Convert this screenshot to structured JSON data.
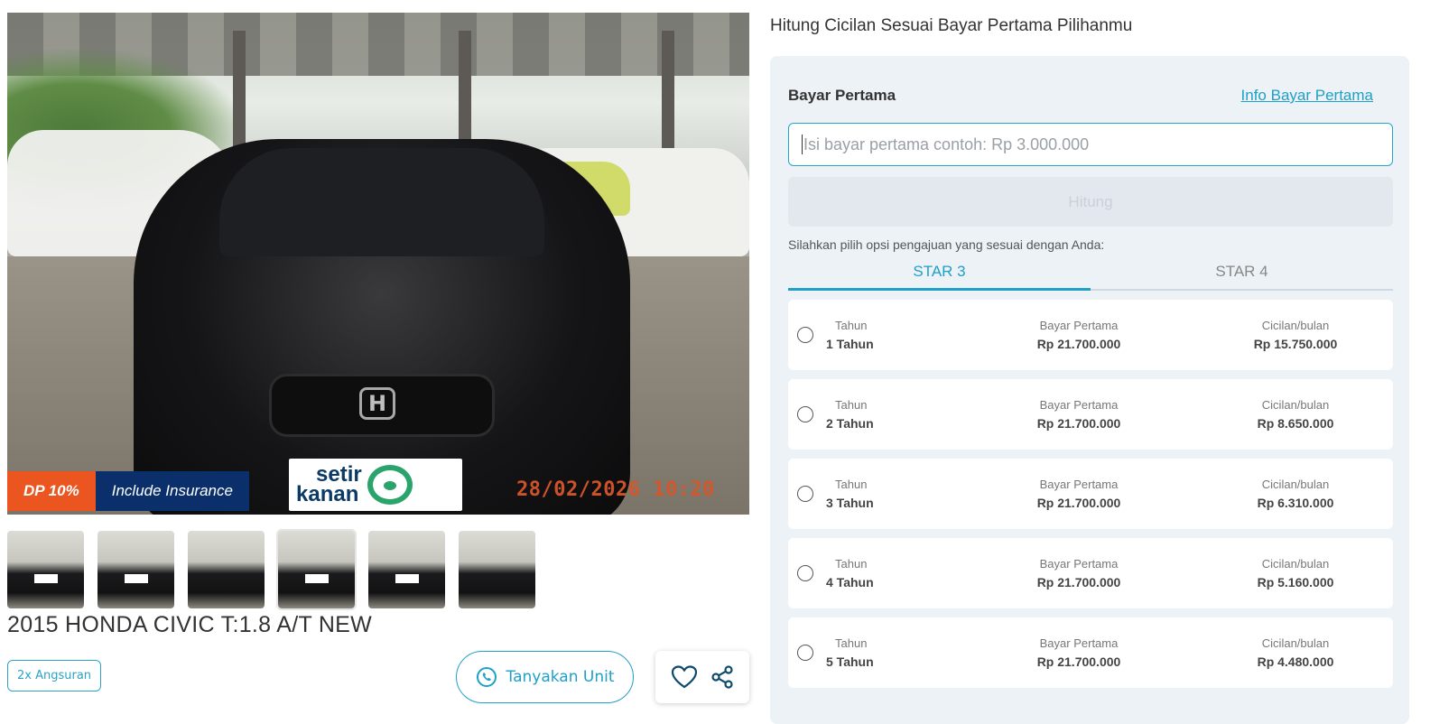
{
  "hero": {
    "dp_badge": "DP 10%",
    "insurance_badge": "Include Insurance",
    "plate_line1": "setir",
    "plate_line2": "kanan",
    "timestamp": "28/02/2026 10:20"
  },
  "car": {
    "title": "2015 HONDA CIVIC T:1.8 A/T NEW"
  },
  "actions": {
    "angsuran": "2x Angsuran",
    "ask_unit": "Tanyakan Unit"
  },
  "calc": {
    "heading": "Hitung Cicilan Sesuai Bayar Pertama Pilihanmu",
    "bayar_pertama_label": "Bayar Pertama",
    "info_link": "Info Bayar Pertama",
    "input_placeholder": "Isi bayar pertama contoh: Rp 3.000.000",
    "hitung_button": "Hitung",
    "hint": "Silahkan pilih opsi pengajuan yang sesuai dengan Anda:",
    "tabs": [
      {
        "label": "STAR 3",
        "active": true
      },
      {
        "label": "STAR 4",
        "active": false
      }
    ],
    "col_tenor_label": "Tahun",
    "col_dp_label": "Bayar Pertama",
    "col_install_label": "Cicilan/bulan",
    "options": [
      {
        "tenor": "1 Tahun",
        "dp": "Rp 21.700.000",
        "installment": "Rp 15.750.000"
      },
      {
        "tenor": "2 Tahun",
        "dp": "Rp 21.700.000",
        "installment": "Rp 8.650.000"
      },
      {
        "tenor": "3 Tahun",
        "dp": "Rp 21.700.000",
        "installment": "Rp 6.310.000"
      },
      {
        "tenor": "4 Tahun",
        "dp": "Rp 21.700.000",
        "installment": "Rp 5.160.000"
      },
      {
        "tenor": "5 Tahun",
        "dp": "Rp 21.700.000",
        "installment": "Rp 4.480.000"
      }
    ]
  },
  "colors": {
    "accent": "#1ea0c8",
    "dp_badge": "#ea5520",
    "insurance_badge": "#0a2f6b",
    "panel_bg": "#ecf2f6"
  },
  "icons": [
    "whatsapp-icon",
    "heart-icon",
    "share-icon"
  ]
}
